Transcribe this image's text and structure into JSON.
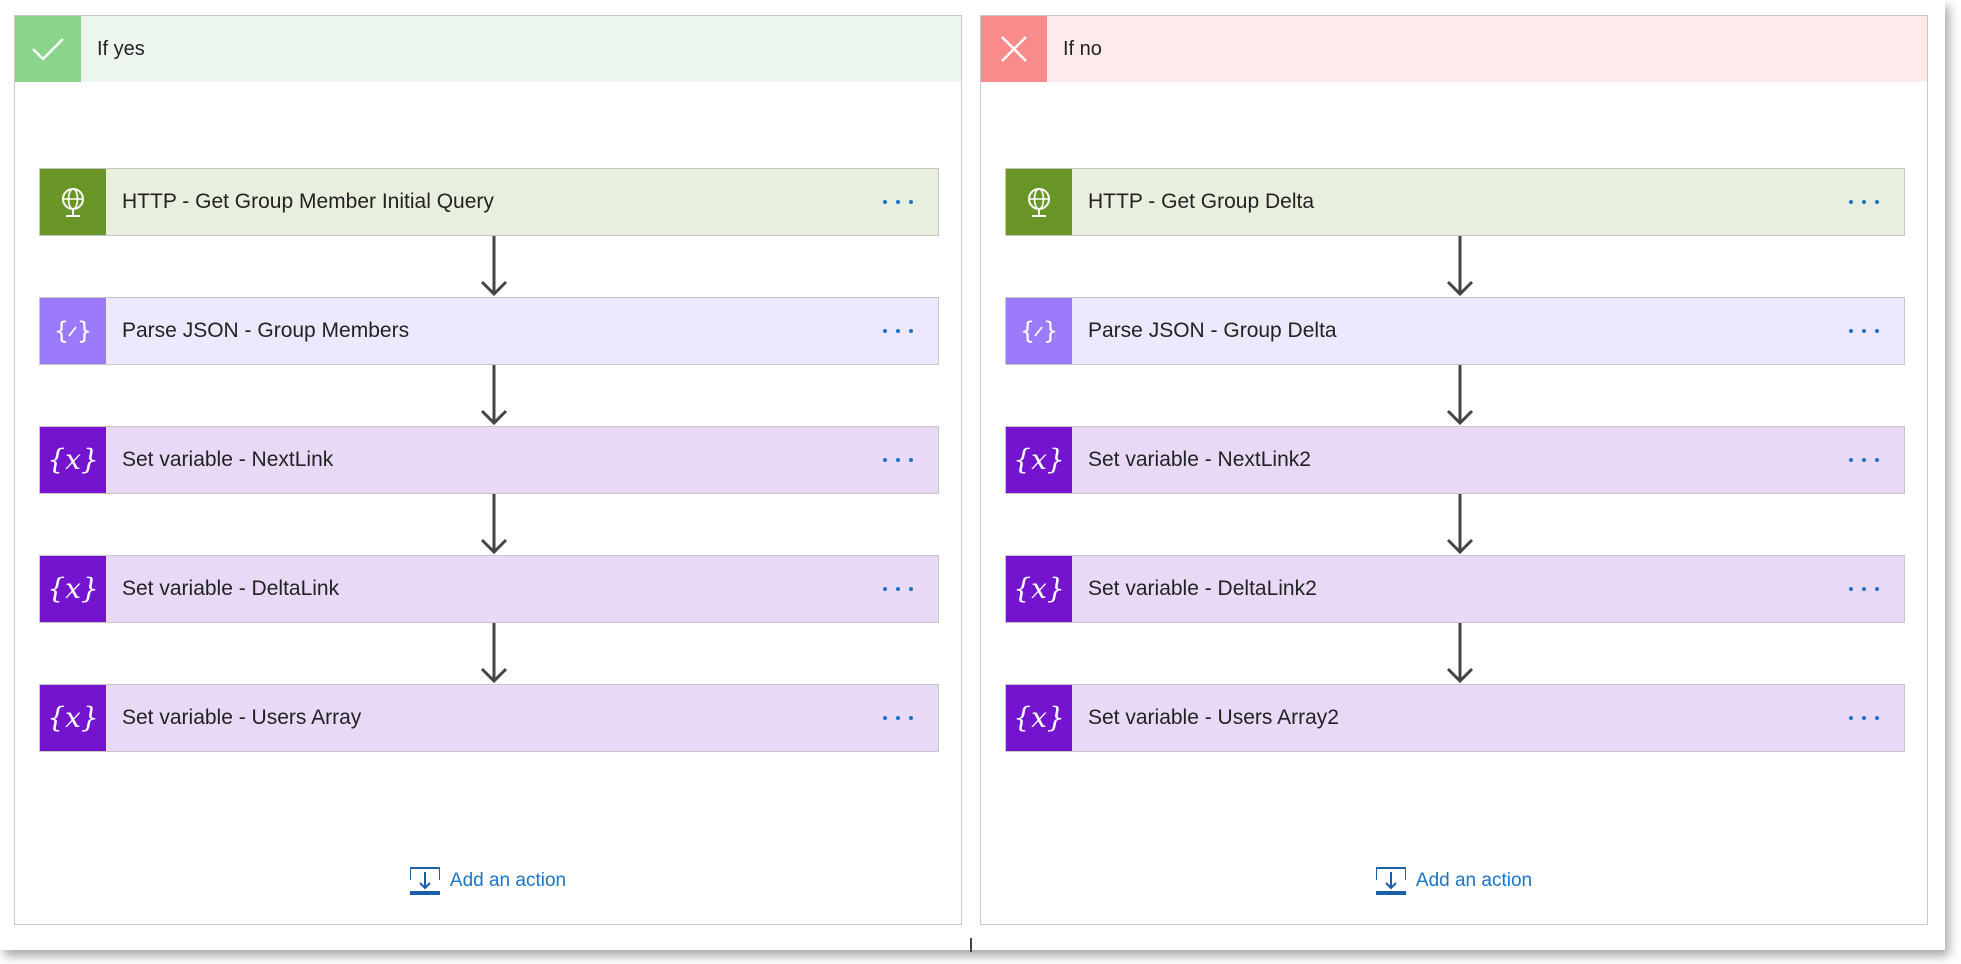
{
  "colors": {
    "yes_header_bg": "#edf6ee",
    "yes_icon_bg": "#8ad48c",
    "no_header_bg": "#fdeaea",
    "no_icon_bg": "#f98b8b",
    "http_icon": "#6a9627",
    "json_icon": "#9b7afc",
    "variable_icon": "#7414cf",
    "link": "#1b74c6"
  },
  "branches": {
    "yes": {
      "title": "If yes",
      "header_icon": "checkmark-icon",
      "actions": [
        {
          "type": "http",
          "icon": "globe-icon",
          "label": "HTTP - Get Group Member Initial Query"
        },
        {
          "type": "json",
          "icon": "parse-json-icon",
          "label": "Parse JSON - Group Members"
        },
        {
          "type": "variable",
          "icon": "variable-icon",
          "label": "Set variable - NextLink"
        },
        {
          "type": "variable",
          "icon": "variable-icon",
          "label": "Set variable - DeltaLink"
        },
        {
          "type": "variable",
          "icon": "variable-icon",
          "label": "Set variable - Users Array"
        }
      ],
      "add_action_label": "Add an action"
    },
    "no": {
      "title": "If no",
      "header_icon": "close-icon",
      "actions": [
        {
          "type": "http",
          "icon": "globe-icon",
          "label": "HTTP - Get Group Delta"
        },
        {
          "type": "json",
          "icon": "parse-json-icon",
          "label": "Parse JSON - Group Delta"
        },
        {
          "type": "variable",
          "icon": "variable-icon",
          "label": "Set variable - NextLink2"
        },
        {
          "type": "variable",
          "icon": "variable-icon",
          "label": "Set variable - DeltaLink2"
        },
        {
          "type": "variable",
          "icon": "variable-icon",
          "label": "Set variable - Users Array2"
        }
      ],
      "add_action_label": "Add an action"
    }
  }
}
